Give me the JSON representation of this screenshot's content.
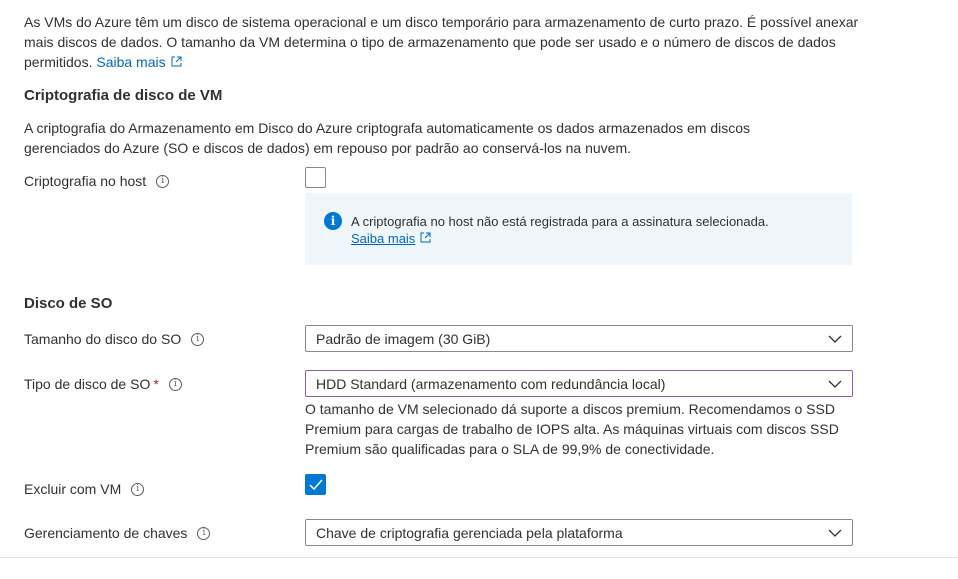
{
  "intro": {
    "text": "As VMs do Azure têm um disco de sistema operacional e um disco temporário para armazenamento de curto prazo. É possível anexar mais discos de dados. O tamanho da VM determina o tipo de armazenamento que pode ser usado e o número de discos de dados permitidos.",
    "link": "Saiba mais"
  },
  "encryption": {
    "title": "Criptografia de disco de VM",
    "description": "A criptografia do Armazenamento em Disco do Azure criptografa automaticamente os dados armazenados em discos gerenciados do Azure (SO e discos de dados) em repouso por padrão ao conservá-los na nuvem.",
    "host_label": "Criptografia no host",
    "host_checked": false,
    "info_message": "A criptografia no host não está registrada para a assinatura selecionada.",
    "info_link": "Saiba mais"
  },
  "os_disk": {
    "title": "Disco de SO",
    "size_label": "Tamanho do disco do SO",
    "size_value": "Padrão de imagem (30 GiB)",
    "type_label": "Tipo de disco de SO",
    "required_mark": "*",
    "type_value": "HDD Standard (armazenamento com redundância local)",
    "type_hint": "O tamanho de VM selecionado dá suporte a discos premium. Recomendamos o SSD Premium para cargas de trabalho de IOPS alta. As máquinas virtuais com discos SSD Premium são qualificadas para o SLA de 99,9% de conectividade.",
    "delete_label": "Excluir com VM",
    "delete_checked": true,
    "key_label": "Gerenciamento de chaves",
    "key_value": "Chave de criptografia gerenciada pela plataforma"
  },
  "colors": {
    "accent": "#0078d4",
    "link": "#0067b8",
    "info_bg": "#eff6fc",
    "required": "#a4262c"
  }
}
